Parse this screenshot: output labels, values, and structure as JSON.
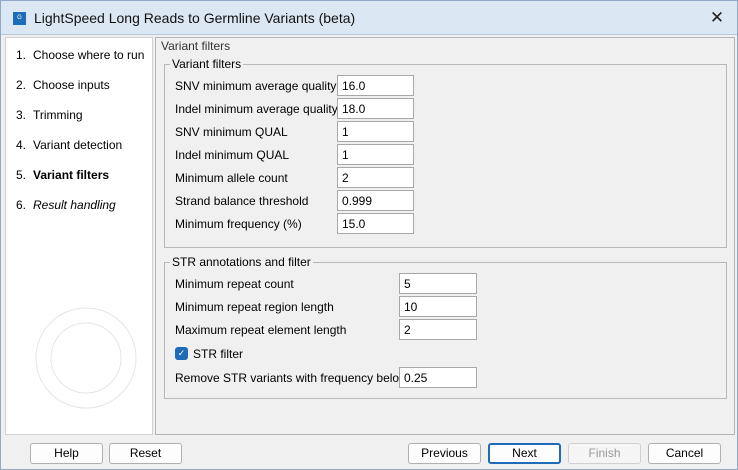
{
  "window": {
    "title": "LightSpeed Long Reads to Germline Variants (beta)"
  },
  "steps": [
    {
      "num": "1.",
      "label": "Choose where to run"
    },
    {
      "num": "2.",
      "label": "Choose inputs"
    },
    {
      "num": "3.",
      "label": "Trimming"
    },
    {
      "num": "4.",
      "label": "Variant detection"
    },
    {
      "num": "5.",
      "label": "Variant filters"
    },
    {
      "num": "6.",
      "label": "Result handling"
    }
  ],
  "main": {
    "section_title": "Variant filters"
  },
  "variant_filters": {
    "title": "Variant filters",
    "fields": [
      {
        "label": "SNV minimum average quality",
        "value": "16.0"
      },
      {
        "label": "Indel minimum average quality",
        "value": "18.0"
      },
      {
        "label": "SNV minimum QUAL",
        "value": "1"
      },
      {
        "label": "Indel minimum QUAL",
        "value": "1"
      },
      {
        "label": "Minimum allele count",
        "value": "2"
      },
      {
        "label": "Strand balance threshold",
        "value": "0.999"
      },
      {
        "label": "Minimum frequency (%)",
        "value": "15.0"
      }
    ]
  },
  "str": {
    "title": "STR annotations and filter",
    "fields": [
      {
        "label": "Minimum repeat count",
        "value": "5"
      },
      {
        "label": "Minimum repeat region length",
        "value": "10"
      },
      {
        "label": "Maximum repeat element length",
        "value": "2"
      }
    ],
    "checkbox_label": "STR filter",
    "checked": true,
    "freq_label": "Remove STR variants with frequency below",
    "freq_value": "0.25"
  },
  "buttons": {
    "help": "Help",
    "reset": "Reset",
    "previous": "Previous",
    "next": "Next",
    "finish": "Finish",
    "cancel": "Cancel"
  }
}
